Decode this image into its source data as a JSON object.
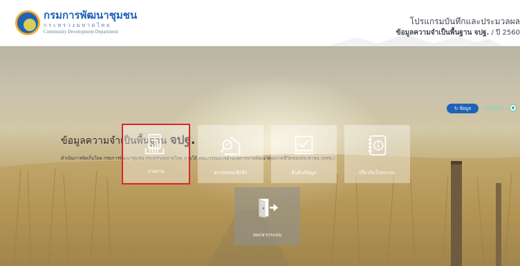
{
  "header": {
    "org_name_th": "กรมการพัฒนาชุมชน",
    "ministry_th": "กระทรวงมหาดไทย",
    "org_name_en": "Community Development Department",
    "program_title": "โปรแกรมบันทึกและประมวลผล",
    "subtitle_bold": "ข้อมูลความจำเป็นพื้นฐาน จปฐ.",
    "subtitle_year": " / ปี 2560"
  },
  "status": {
    "info_button_label": "ข้อมูล",
    "online_label": "Online"
  },
  "hero": {
    "title_prefix": "ข้อมูลความจำเป็นพื้นฐาน ",
    "title_bold": "จปฐ.",
    "description": "ดำเนินการจัดเก็บโดย กรมการพัฒนาชุมชน กระทรวงมหาดไทย ภายใต้ คณะกรรมการอำนวยการงานพัฒนาคุณภาพชีวิตของประชาชน (พชช.)"
  },
  "menu": [
    {
      "label": "รายงาน",
      "icon": "report-icon",
      "selected": true
    },
    {
      "label": "ตรวจสอบเชิงลึก",
      "icon": "inspect-icon",
      "selected": false
    },
    {
      "label": "ยืนยันข้อมูล",
      "icon": "confirm-icon",
      "selected": false
    },
    {
      "label": "เกี่ยวกับโปรแกรม",
      "icon": "about-icon",
      "selected": false
    },
    {
      "label": "ออกจากระบบ",
      "icon": "logout-icon",
      "selected": false
    }
  ],
  "colors": {
    "brand_blue": "#1f63b5",
    "online_teal": "#2bb39d",
    "selection_red": "#d9252a"
  }
}
